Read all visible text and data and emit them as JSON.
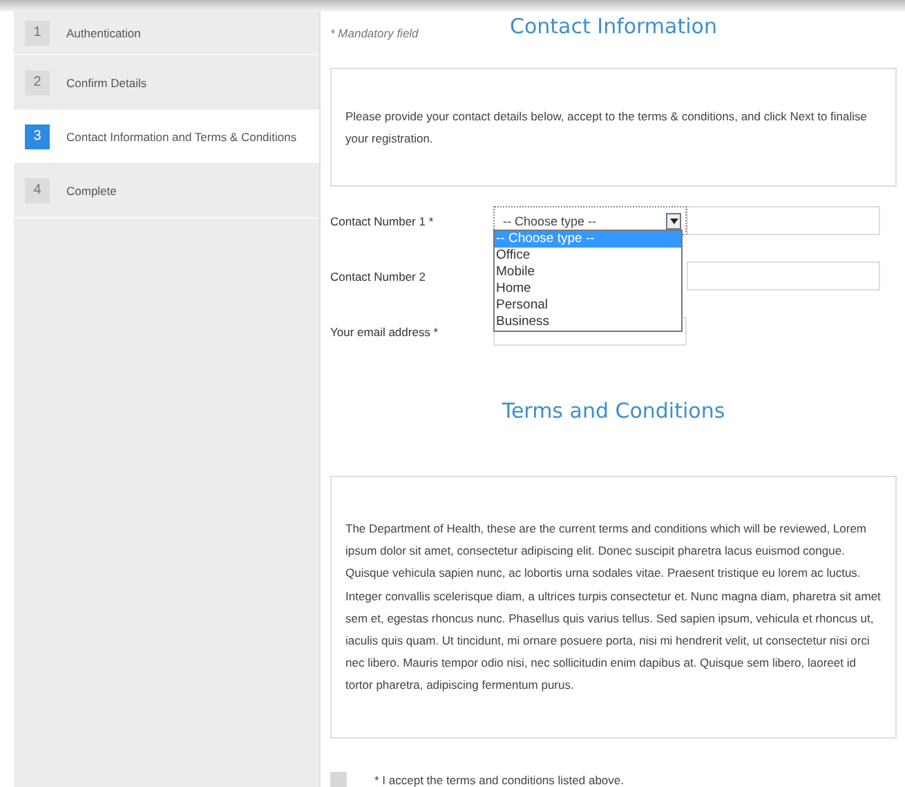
{
  "steps": [
    {
      "number": "1",
      "label": "Authentication",
      "selected": false
    },
    {
      "number": "2",
      "label": "Confirm Details",
      "selected": false
    },
    {
      "number": "3",
      "label": "Contact Information and Terms & Conditions",
      "selected": true
    },
    {
      "number": "4",
      "label": "Complete",
      "selected": false
    }
  ],
  "mandatory_note": "* Mandatory field",
  "contact_heading": "Contact Information",
  "intro": "Please provide your contact details below, accept to the terms & conditions, and click Next to finalise your registration.",
  "fields": [
    {
      "kind": "type_and_number",
      "label": "Contact Number 1 *",
      "select_value": "-- Choose type --",
      "dropdown": {
        "expanded": true,
        "options": [
          {
            "label": "-- Choose type --",
            "selected": true
          },
          {
            "label": "Office",
            "selected": false
          },
          {
            "label": "Mobile",
            "selected": false
          },
          {
            "label": "Home",
            "selected": false
          },
          {
            "label": "Personal",
            "selected": false
          },
          {
            "label": "Business",
            "selected": false
          }
        ]
      }
    },
    {
      "kind": "number_only",
      "label": "Contact Number 2"
    },
    {
      "kind": "email",
      "label": "Your email address *"
    }
  ],
  "terms_heading": "Terms and Conditions",
  "terms_text": "The Department of Health, these are the current terms and conditions which will be reviewed, Lorem ipsum dolor sit amet, consectetur adipiscing elit. Donec suscipit pharetra lacus euismod congue. Quisque vehicula sapien nunc, ac lobortis urna sodales vitae. Praesent tristique eu lorem ac luctus. Integer convallis scelerisque diam, a ultrices turpis consectetur et. Nunc magna diam, pharetra sit amet sem et, egestas rhoncus nunc. Phasellus quis varius tellus. Sed sapien ipsum, vehicula et rhoncus ut, iaculis quis quam. Ut tincidunt, mi ornare posuere porta, nisi mi hendrerit velit, ut consectetur nisi orci nec libero. Mauris tempor odio nisi, nec sollicitudin enim dapibus at. Quisque sem libero, laoreet id tortor pharetra, adipiscing fermentum purus.",
  "accept": {
    "label": "* I accept the terms and conditions listed above.",
    "checked": false
  }
}
